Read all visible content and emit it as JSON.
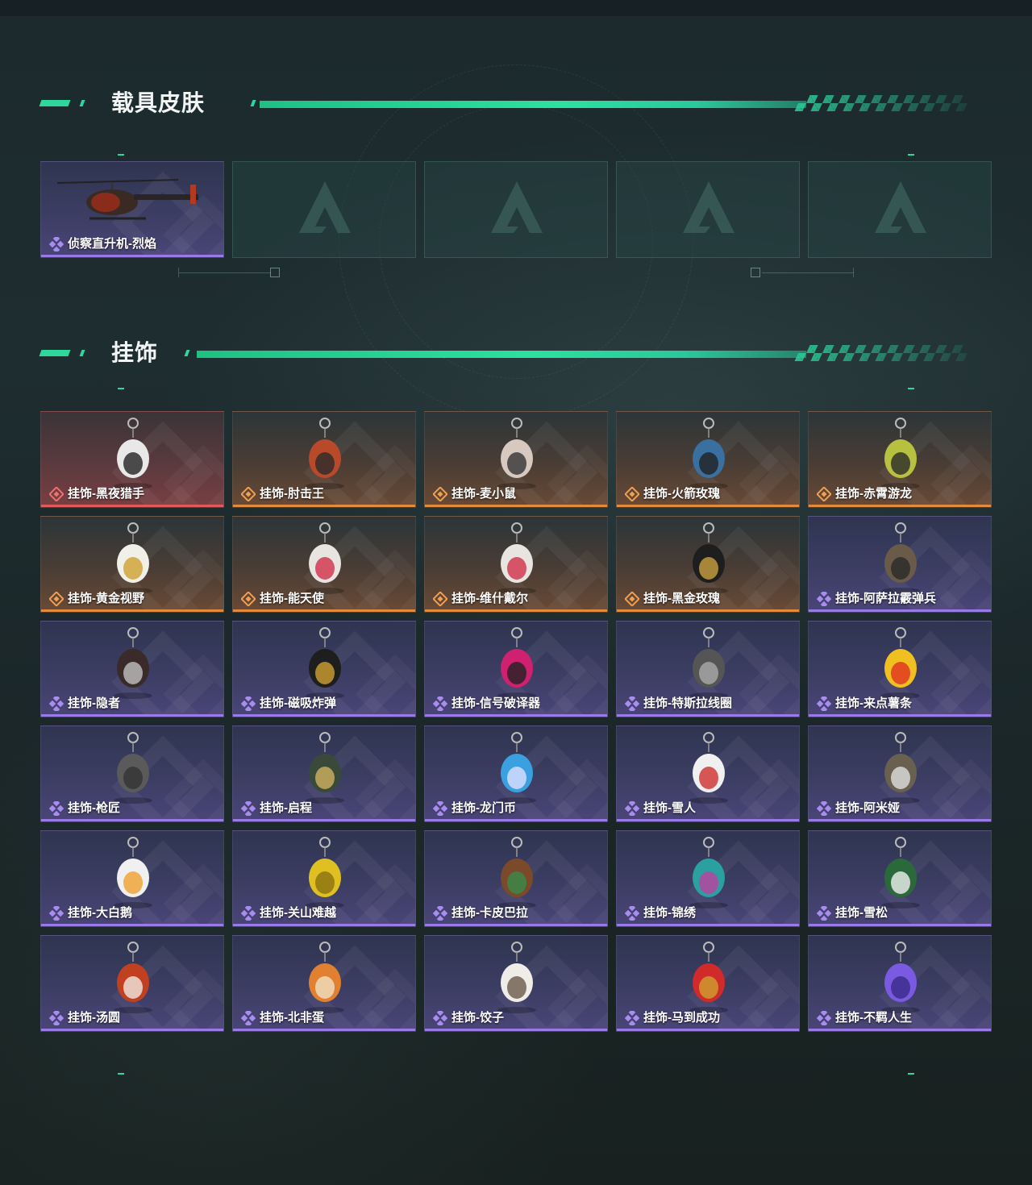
{
  "sections": {
    "vehicle": {
      "title": "载具皮肤"
    },
    "pendant": {
      "title": "挂饰"
    }
  },
  "colors": {
    "accent": "#2fd79a",
    "purple_stripe": "#9a7ae8",
    "orange_stripe": "#e48a3c",
    "red_stripe": "#e05a5a"
  },
  "vehicle_items": [
    {
      "name": "侦察直升机-烈焰",
      "rarity": "purple",
      "icon": "helicopter-icon"
    },
    {
      "name": "",
      "rarity": "empty"
    },
    {
      "name": "",
      "rarity": "empty"
    },
    {
      "name": "",
      "rarity": "empty"
    },
    {
      "name": "",
      "rarity": "empty"
    }
  ],
  "pendant_items": [
    {
      "name": "挂饰-黑夜猎手",
      "rarity": "red",
      "icon": "hunter-figure-icon"
    },
    {
      "name": "挂饰-肘击王",
      "rarity": "orange",
      "icon": "soldier-figure-icon"
    },
    {
      "name": "挂饰-麦小鼠",
      "rarity": "orange",
      "icon": "mouse-figure-icon"
    },
    {
      "name": "挂饰-火箭玫瑰",
      "rarity": "orange",
      "icon": "rocket-figure-icon"
    },
    {
      "name": "挂饰-赤霄游龙",
      "rarity": "orange",
      "icon": "dragon-figure-icon"
    },
    {
      "name": "挂饰-黄金视野",
      "rarity": "orange",
      "icon": "gold-figure-icon"
    },
    {
      "name": "挂饰-能天使",
      "rarity": "orange",
      "icon": "card-pendant-icon"
    },
    {
      "name": "挂饰-维什戴尔",
      "rarity": "orange",
      "icon": "card-pendant-icon"
    },
    {
      "name": "挂饰-黑金玫瑰",
      "rarity": "orange",
      "icon": "rose-pendant-icon"
    },
    {
      "name": "挂饰-阿萨拉霰弹兵",
      "rarity": "purple",
      "icon": "shotgunner-figure-icon"
    },
    {
      "name": "挂饰-隐者",
      "rarity": "purple",
      "icon": "tarot-card-icon"
    },
    {
      "name": "挂饰-磁吸炸弹",
      "rarity": "purple",
      "icon": "bomb-icon"
    },
    {
      "name": "挂饰-信号破译器",
      "rarity": "purple",
      "icon": "device-icon"
    },
    {
      "name": "挂饰-特斯拉线圈",
      "rarity": "purple",
      "icon": "coil-icon"
    },
    {
      "name": "挂饰-来点薯条",
      "rarity": "purple",
      "icon": "fries-icon"
    },
    {
      "name": "挂饰-枪匠",
      "rarity": "purple",
      "icon": "gun-case-icon"
    },
    {
      "name": "挂饰-启程",
      "rarity": "purple",
      "icon": "medal-icon"
    },
    {
      "name": "挂饰-龙门币",
      "rarity": "purple",
      "icon": "coin-card-icon"
    },
    {
      "name": "挂饰-雪人",
      "rarity": "purple",
      "icon": "snowman-icon"
    },
    {
      "name": "挂饰-阿米娅",
      "rarity": "purple",
      "icon": "bunny-figure-icon"
    },
    {
      "name": "挂饰-大白鹅",
      "rarity": "purple",
      "icon": "goose-icon"
    },
    {
      "name": "挂饰-关山难越",
      "rarity": "purple",
      "icon": "gold-bar-icon"
    },
    {
      "name": "挂饰-卡皮巴拉",
      "rarity": "purple",
      "icon": "capybara-icon"
    },
    {
      "name": "挂饰-锦绣",
      "rarity": "purple",
      "icon": "butterfly-icon"
    },
    {
      "name": "挂饰-雪松",
      "rarity": "purple",
      "icon": "tree-icon"
    },
    {
      "name": "挂饰-汤圆",
      "rarity": "purple",
      "icon": "bowl-icon"
    },
    {
      "name": "挂饰-北非蛋",
      "rarity": "purple",
      "icon": "pan-icon"
    },
    {
      "name": "挂饰-饺子",
      "rarity": "purple",
      "icon": "dumpling-plate-icon"
    },
    {
      "name": "挂饰-马到成功",
      "rarity": "purple",
      "icon": "horse-icon"
    },
    {
      "name": "挂饰-不羁人生",
      "rarity": "purple",
      "icon": "sneaker-icon"
    }
  ]
}
